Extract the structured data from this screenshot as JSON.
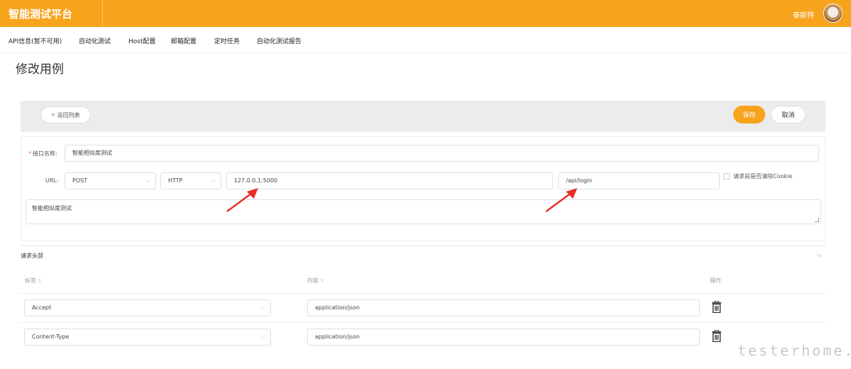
{
  "header": {
    "brand": "智能测试平台",
    "user": "泰斯特"
  },
  "nav": {
    "items": [
      "API信息(暂不可用)",
      "自动化测试",
      "Host配置",
      "邮箱配置",
      "定时任务",
      "自动化测试报告"
    ]
  },
  "page": {
    "title": "修改用例"
  },
  "actions": {
    "back": "返回列表",
    "save": "保存",
    "cancel": "取消"
  },
  "form": {
    "name_label": "接口名称:",
    "name_value": "智能相似度测试",
    "url_label": "URL:",
    "method": "POST",
    "protocol": "HTTP",
    "host": "127.0.0.1:5000",
    "path": "/api/login",
    "clear_cookie_label": "请求前是否清除Cookie",
    "clear_cookie_checked": false,
    "description": "智能相似度测试"
  },
  "headers_section": {
    "title": "请求头部",
    "columns": {
      "key": "标签",
      "value": "内容",
      "action": "操作"
    },
    "rows": [
      {
        "key": "Accept",
        "value": "application/json"
      },
      {
        "key": "Content-Type",
        "value": "application/json"
      }
    ]
  },
  "watermark": "testerhome.com",
  "colors": {
    "accent": "#f7a31c",
    "annotation": "#e8302a"
  }
}
